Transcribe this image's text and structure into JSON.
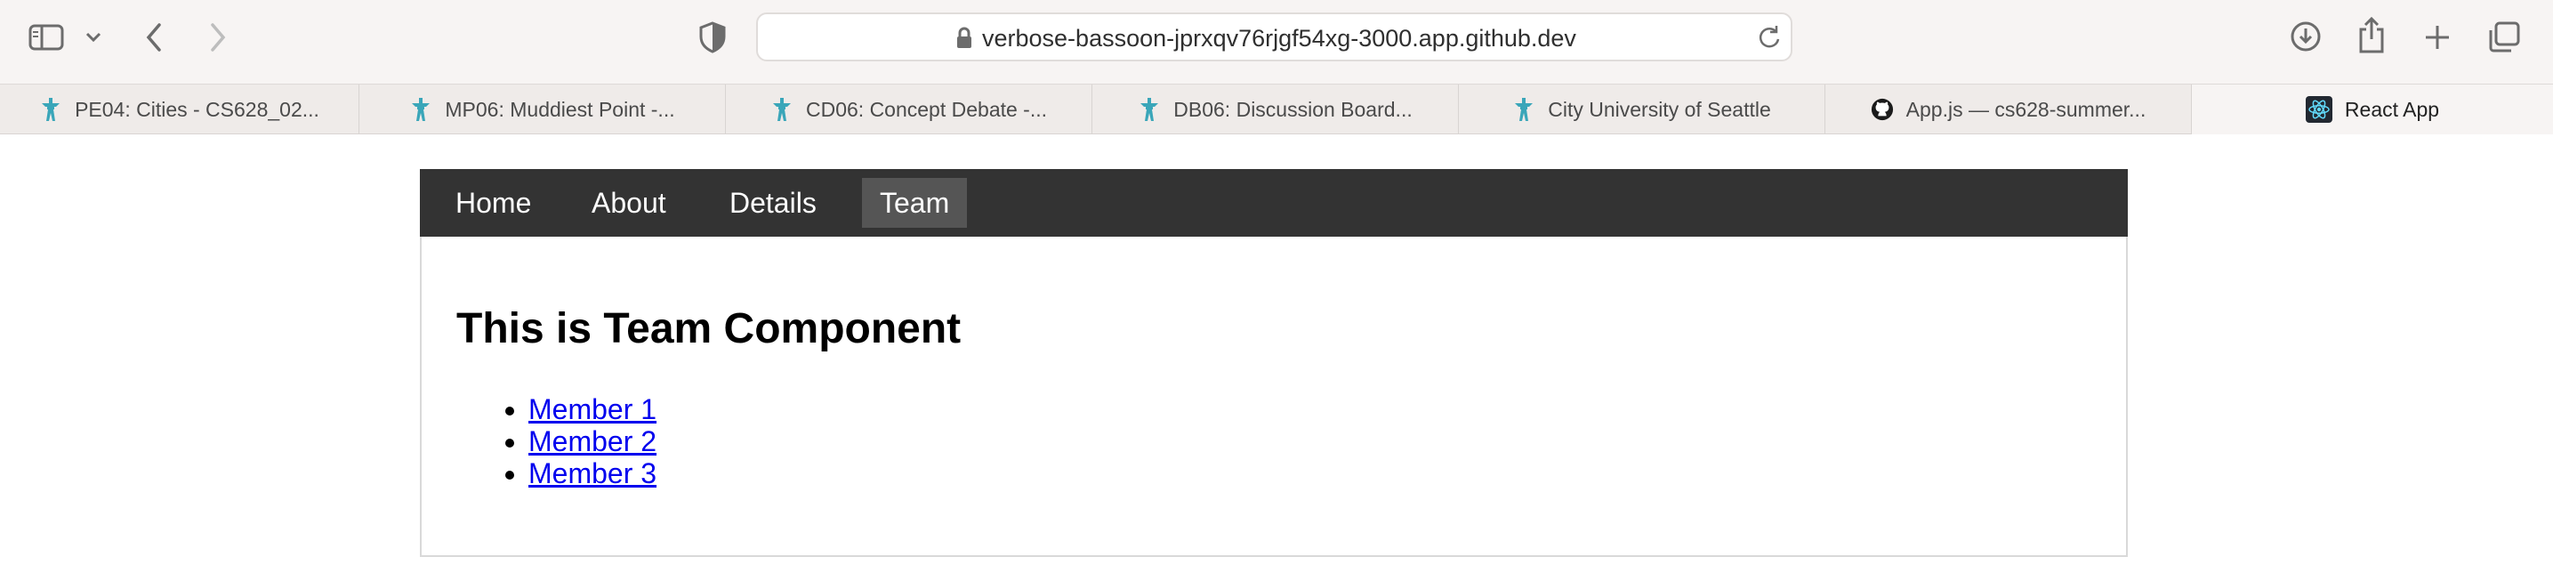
{
  "browser": {
    "url": "verbose-bassoon-jprxqv76rjgf54xg-3000.app.github.dev",
    "tabs": [
      {
        "label": "PE04: Cities - CS628_02...",
        "icon": "needle-icon"
      },
      {
        "label": "MP06: Muddiest Point -...",
        "icon": "needle-icon"
      },
      {
        "label": "CD06: Concept Debate -...",
        "icon": "needle-icon"
      },
      {
        "label": "DB06: Discussion Board...",
        "icon": "needle-icon"
      },
      {
        "label": "City University of Seattle",
        "icon": "needle-icon"
      },
      {
        "label": "App.js — cs628-summer...",
        "icon": "github-icon"
      },
      {
        "label": "React App",
        "icon": "react-icon"
      }
    ]
  },
  "nav": {
    "home": "Home",
    "about": "About",
    "details": "Details",
    "team": "Team",
    "active": "Team"
  },
  "content": {
    "title": "This is Team Component",
    "members": [
      "Member 1",
      "Member 2",
      "Member 3"
    ]
  },
  "colors": {
    "navbar_bg": "#333333",
    "nav_active_bg": "#555555",
    "link": "#0000ee",
    "needle_icon": "#3aa6b9"
  }
}
